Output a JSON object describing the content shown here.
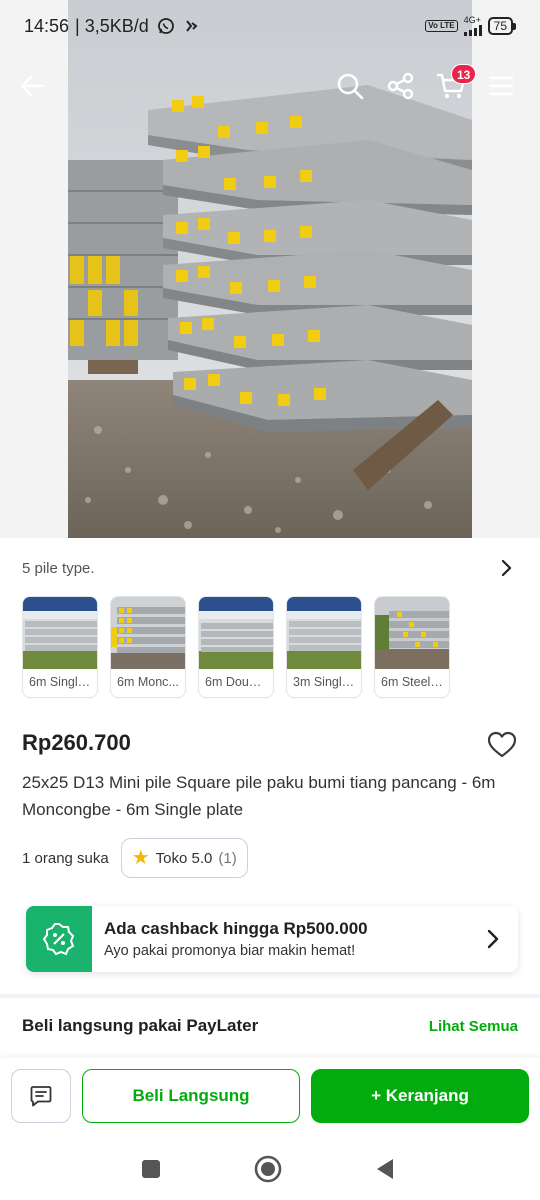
{
  "status_bar": {
    "time": "14:56",
    "network_speed": "| 3,5KB/d",
    "volte": "Vo LTE",
    "network_type": "4G+",
    "battery": "75"
  },
  "top_nav": {
    "cart_count": "13"
  },
  "variants": {
    "title": "5 pile type.",
    "items": [
      {
        "label": "6m Single..."
      },
      {
        "label": "6m Monc..."
      },
      {
        "label": "6m Doubl..."
      },
      {
        "label": "3m Single..."
      },
      {
        "label": "6m Steel ..."
      }
    ]
  },
  "product": {
    "price": "Rp260.700",
    "title": "25x25 D13 Mini pile Square pile paku bumi tiang pancang - 6m Moncongbe - 6m Single plate",
    "likes": "1 orang suka",
    "rating_label": "Toko 5.0",
    "rating_count": "(1)"
  },
  "cashback": {
    "title": "Ada cashback hingga Rp500.000",
    "subtitle": "Ayo pakai promonya biar makin hemat!"
  },
  "paylater": {
    "title": "Beli langsung pakai PayLater",
    "link": "Lihat Semua"
  },
  "actions": {
    "buy_now": "Beli Langsung",
    "add_to_cart": "+ Keranjang"
  },
  "colors": {
    "brand_green": "#03ac0e",
    "cashback_green": "#19b36e",
    "badge_red": "#e8264d",
    "star": "#f5b800"
  },
  "icons": {
    "back": "arrow-left-icon",
    "search": "search-icon",
    "share": "share-icon",
    "cart": "cart-icon",
    "menu": "hamburger-icon",
    "wishlist": "heart-icon",
    "chat": "chat-icon",
    "variants_more": "chevron-right-icon",
    "cashback": "discount-badge-icon"
  }
}
